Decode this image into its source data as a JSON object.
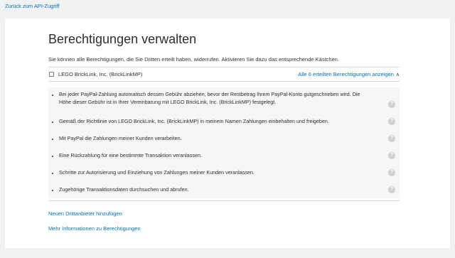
{
  "nav": {
    "back_label": "Zurück zum API-Zugriff"
  },
  "page": {
    "title": "Berechtigungen verwalten",
    "intro": "Sie können alle Berechtigungen, die Sie Dritten erteilt haben, widerrufen. Aktivieren Sie dazu das entsprechende Kästchen."
  },
  "third_party": {
    "name": "LEGO BrickLink, Inc. (BrickLinkMP)",
    "checked": false,
    "show_all_label": "Alle 6 erteilten Berechtigungen anzeigen",
    "expanded_icon": "chevron-up-icon"
  },
  "permissions": [
    {
      "line1": "Bei jeder PayPal-Zahlung automatisch dessen Gebühr abziehen, bevor der Restbetrag Ihrem PayPal-Konto gutgeschrieben wird. Die",
      "line2": "Höhe dieser Gebühr ist in Ihrer Vereinbarung mit LEGO BrickLink, Inc. (BrickLinkMP) festgelegt.",
      "help": "?"
    },
    {
      "line1": "Gemäß der Richtlinie von LEGO BrickLink, Inc. (BrickLinkMP) in meinem Namen Zahlungen einbehalten und freigeben.",
      "help": "?"
    },
    {
      "line1": "Mit PayPal die Zahlungen meiner Kunden verarbeiten.",
      "help": "?"
    },
    {
      "line1": "Eine Rückzahlung für eine bestimmte Transaktion veranlassen.",
      "help": "?"
    },
    {
      "line1": "Schritte zur Autorisierung und Einziehung von Zahlungen meiner Kunden veranlassen.",
      "help": "?"
    },
    {
      "line1": "Zugehörige Transaktionsdaten durchsuchen und abrufen.",
      "help": "?"
    }
  ],
  "footer_links": {
    "add_third_party": "Neuen Drittanbieter hinzufügen",
    "more_info": "Mehr Informationen zu Berechtigungen"
  },
  "colors": {
    "link": "#0070ba",
    "panel_bg": "#f5f6f7",
    "page_bg": "#f1f2f3"
  }
}
